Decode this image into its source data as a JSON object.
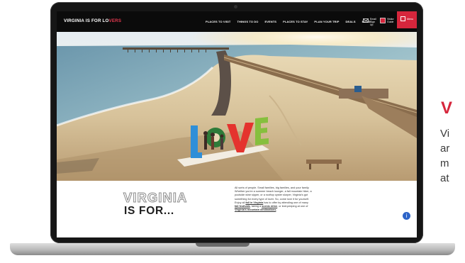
{
  "site": {
    "logo_text_before": "VIRGINIA IS FOR LO",
    "logo_text_highlight": "VERS"
  },
  "nav": {
    "items": [
      "PLACES TO VISIT",
      "THINGS TO DO",
      "EVENTS",
      "PLACES TO STAY",
      "PLAN YOUR TRIP",
      "DEALS",
      "BLOG"
    ],
    "newsletter_label": "Email Sign Up",
    "guide_label": "Visitor Guide",
    "menu_label": "Menu"
  },
  "hero": {
    "sign_letters": [
      "L",
      "O",
      "V",
      "E"
    ]
  },
  "intro": {
    "headline_outline": "VIRGINIA",
    "headline_solid": "IS FOR...",
    "para_lines": [
      "All sorts of people. Small families, big families, and your family.",
      "Whether you're a summer beach lounger, a fall mountain hiker, a",
      "poolside wine sipper, or a rooftop oyster slurper, Virginia's got",
      "something for every type of lover. So, come love it for yourself.",
      "Enjoy all"
    ],
    "link_fall": "fall in Virginia",
    "text_after_fall": " has to offer by attending one of many",
    "link_festivals": "fall festivals",
    "text_taking": ", taking a ",
    "link_scenic": "scenic drive",
    "text_leaf": ", or leaf-peeping at one of",
    "link_mountain": "Virginia's mountain destinations",
    "text_end": "."
  },
  "accessibility_label": "i",
  "side_text": {
    "heading": "V",
    "lines": [
      "Vi",
      "ar",
      "m",
      "at"
    ]
  },
  "colors": {
    "brand_red": "#d6263c",
    "nav_bg": "#0b0b0b"
  }
}
